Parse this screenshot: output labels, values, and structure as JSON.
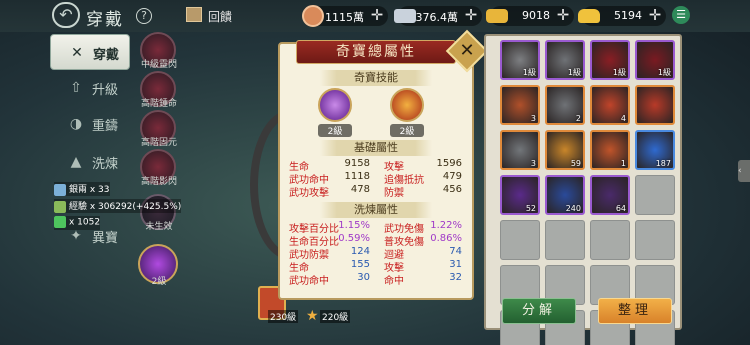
{
  "header": {
    "title": "穿戴",
    "gift_label": "回饋",
    "menu_icon": "list-icon"
  },
  "resources": [
    {
      "name": "copper",
      "value": "1115萬",
      "color": "#d98a5a"
    },
    {
      "name": "silver",
      "value": "376.4萬",
      "color": "#c9d2dc"
    },
    {
      "name": "gold",
      "value": "9018",
      "color": "#e8b53a"
    },
    {
      "name": "ingot",
      "value": "5194",
      "color": "#f0c23c"
    }
  ],
  "left_menu": [
    {
      "label": "穿戴",
      "icon": "crossed-swords-icon",
      "active": true
    },
    {
      "label": "升級",
      "icon": "up-arrow-icon",
      "active": false
    },
    {
      "label": "重鑄",
      "icon": "forge-icon",
      "active": false
    },
    {
      "label": "洗煉",
      "icon": "refine-icon",
      "active": false
    },
    {
      "label": "異寶",
      "icon": "treasure-icon",
      "active": false
    }
  ],
  "slots": [
    {
      "label": "中級靈閃"
    },
    {
      "label": "高階鍾命"
    },
    {
      "label": "高階固元"
    },
    {
      "label": "高階影閃"
    },
    {
      "label": "未生效"
    },
    {
      "label": "2級"
    }
  ],
  "buffs": [
    {
      "text": "銀兩 x 33",
      "color": "#7cb0d8"
    },
    {
      "text": "經驗 x 306292(+425.5%)",
      "color": "#8aba5a"
    },
    {
      "text": "x 1052",
      "color": "#4ec45e"
    }
  ],
  "bottom_badges": [
    "230級",
    "220級"
  ],
  "panel": {
    "title": "奇寶總屬性",
    "skill_section": "奇寶技能",
    "skills": [
      {
        "level": "2級",
        "icon": "purple-orb-icon"
      },
      {
        "level": "2級",
        "icon": "fire-skill-icon"
      }
    ],
    "base_section": "基礎屬性",
    "base_stats": [
      [
        "生命",
        "9158",
        "攻擊",
        "1596"
      ],
      [
        "武功命中",
        "1118",
        "追傷抵抗",
        "479"
      ],
      [
        "武功攻擊",
        "478",
        "防禦",
        "456"
      ]
    ],
    "refine_section": "洗煉屬性",
    "refine_stats": [
      [
        "攻擊百分比",
        "1.15%",
        "武功免傷",
        "1.22%"
      ],
      [
        "生命百分比",
        "0.59%",
        "普攻免傷",
        "0.86%"
      ],
      [
        "武功防禦",
        "124",
        "迴避",
        "74"
      ],
      [
        "生命",
        "155",
        "攻擊",
        "31"
      ],
      [
        "武功命中",
        "30",
        "命中",
        "32"
      ]
    ]
  },
  "inventory": {
    "items": [
      {
        "count": "1級",
        "color": "#7d7f82",
        "border": "#9a5ad0"
      },
      {
        "count": "1級",
        "color": "#6f7276",
        "border": "#9a5ad0"
      },
      {
        "count": "1級",
        "color": "#8a1e24",
        "border": "#9a5ad0"
      },
      {
        "count": "1級",
        "color": "#7a1a22",
        "border": "#9a5ad0"
      },
      {
        "count": "3",
        "color": "#b0502a",
        "border": "#e08a3a"
      },
      {
        "count": "2",
        "color": "#6f7276",
        "border": "#e08a3a"
      },
      {
        "count": "4",
        "color": "#c0442a",
        "border": "#e08a3a"
      },
      {
        "count": "",
        "color": "#b83a28",
        "border": "#e08a3a"
      },
      {
        "count": "3",
        "color": "#72767a",
        "border": "#e08a3a"
      },
      {
        "count": "59",
        "color": "#c9862a",
        "border": "#e08a3a"
      },
      {
        "count": "1",
        "color": "#c0542a",
        "border": "#e08a3a"
      },
      {
        "count": "187",
        "color": "#2f6ad0",
        "border": "#4a8ae0"
      },
      {
        "count": "52",
        "color": "#5a2a8a",
        "border": "#9a5ad0"
      },
      {
        "count": "240",
        "color": "#2a4a9a",
        "border": "#9a5ad0"
      },
      {
        "count": "64",
        "color": "#4a2a6a",
        "border": "#9a5ad0"
      }
    ],
    "empty_cells": 13,
    "decompose_label": "分解",
    "sort_label": "整理"
  },
  "side_tab_icon": "chevron-left-icon"
}
